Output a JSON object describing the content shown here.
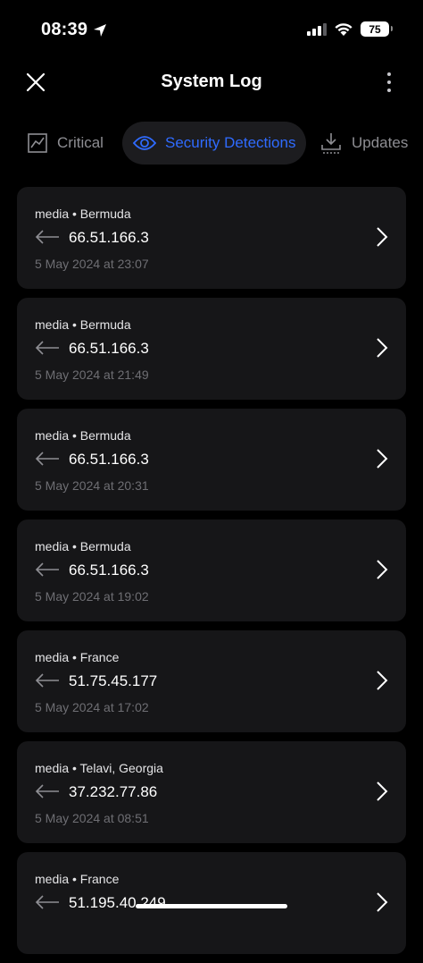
{
  "status_bar": {
    "time": "08:39",
    "battery": "75"
  },
  "header": {
    "title": "System Log"
  },
  "tabs": [
    {
      "label": "Critical",
      "icon": "chart-icon"
    },
    {
      "label": "Security Detections",
      "icon": "eye-icon"
    },
    {
      "label": "Updates",
      "icon": "download-icon"
    }
  ],
  "logs": [
    {
      "source": "media • Bermuda",
      "ip": "66.51.166.3",
      "time": "5 May 2024 at 23:07"
    },
    {
      "source": "media • Bermuda",
      "ip": "66.51.166.3",
      "time": "5 May 2024 at 21:49"
    },
    {
      "source": "media • Bermuda",
      "ip": "66.51.166.3",
      "time": "5 May 2024 at 20:31"
    },
    {
      "source": "media • Bermuda",
      "ip": "66.51.166.3",
      "time": "5 May 2024 at 19:02"
    },
    {
      "source": "media • France",
      "ip": "51.75.45.177",
      "time": "5 May 2024 at 17:02"
    },
    {
      "source": "media • Telavi, Georgia",
      "ip": "37.232.77.86",
      "time": "5 May 2024 at 08:51"
    },
    {
      "source": "media • France",
      "ip": "51.195.40.249",
      "time": ""
    }
  ],
  "colors": {
    "accent": "#2f6bff",
    "card": "#161618",
    "background": "#000000"
  }
}
